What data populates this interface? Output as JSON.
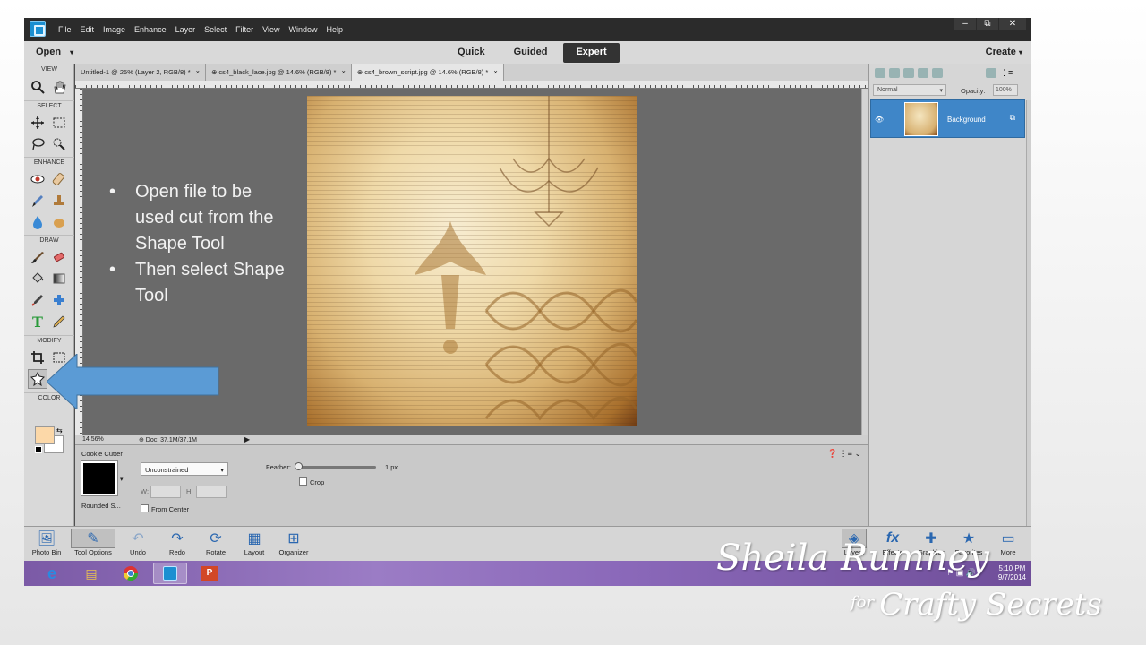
{
  "app": {
    "menu": [
      "File",
      "Edit",
      "Image",
      "Enhance",
      "Layer",
      "Select",
      "Filter",
      "View",
      "Window",
      "Help"
    ],
    "window_controls": [
      "–",
      "⧉",
      "✕"
    ]
  },
  "modebar": {
    "open_label": "Open",
    "modes": [
      "Quick",
      "Guided",
      "Expert"
    ],
    "active_mode": "Expert",
    "create_label": "Create"
  },
  "toolbox": {
    "sections": [
      "VIEW",
      "SELECT",
      "ENHANCE",
      "DRAW",
      "MODIFY",
      "COLOR"
    ],
    "foreground_color": "#fcd8a8",
    "background_color": "#ffffff"
  },
  "documents": {
    "tabs": [
      "Untitled-1 @ 25% (Layer 2, RGB/8) *",
      "⊕ cs4_black_lace.jpg @ 14.6% (RGB/8) *",
      "⊕ cs4_brown_script.jpg @ 14.6% (RGB/8) *"
    ],
    "active_index": 2
  },
  "statusbar": {
    "zoom": "14.56%",
    "doc_size": "⊕ Doc: 37.1M/37.1M"
  },
  "tool_options": {
    "tool_name": "Cookie Cutter",
    "shape_name": "Rounded S...",
    "constraint": "Unconstrained",
    "w_label": "W:",
    "h_label": "H:",
    "from_center_label": "From Center",
    "feather_label": "Feather:",
    "feather_value": "1 px",
    "feather_fraction": 0.0,
    "crop_label": "Crop"
  },
  "layers_panel": {
    "blend_mode": "Normal",
    "opacity_label": "Opacity:",
    "opacity_value": "100%",
    "layer_name": "Background"
  },
  "bottom_bar": {
    "left": [
      "Photo Bin",
      "Tool Options",
      "Undo",
      "Redo",
      "Rotate",
      "Layout",
      "Organizer"
    ],
    "right": [
      "Layers",
      "Effects",
      "Graphics",
      "Favorites",
      "More"
    ]
  },
  "taskbar": {
    "time": "5:10 PM",
    "date": "9/7/2014"
  },
  "overlay": {
    "bullets": [
      "Open file to be used cut from the Shape Tool",
      "Then select Shape Tool"
    ],
    "arrow_color": "#5b9bd5",
    "signature_line1": "Sheila Rumney",
    "signature_for": "for",
    "signature_line2": "Crafty Secrets"
  }
}
